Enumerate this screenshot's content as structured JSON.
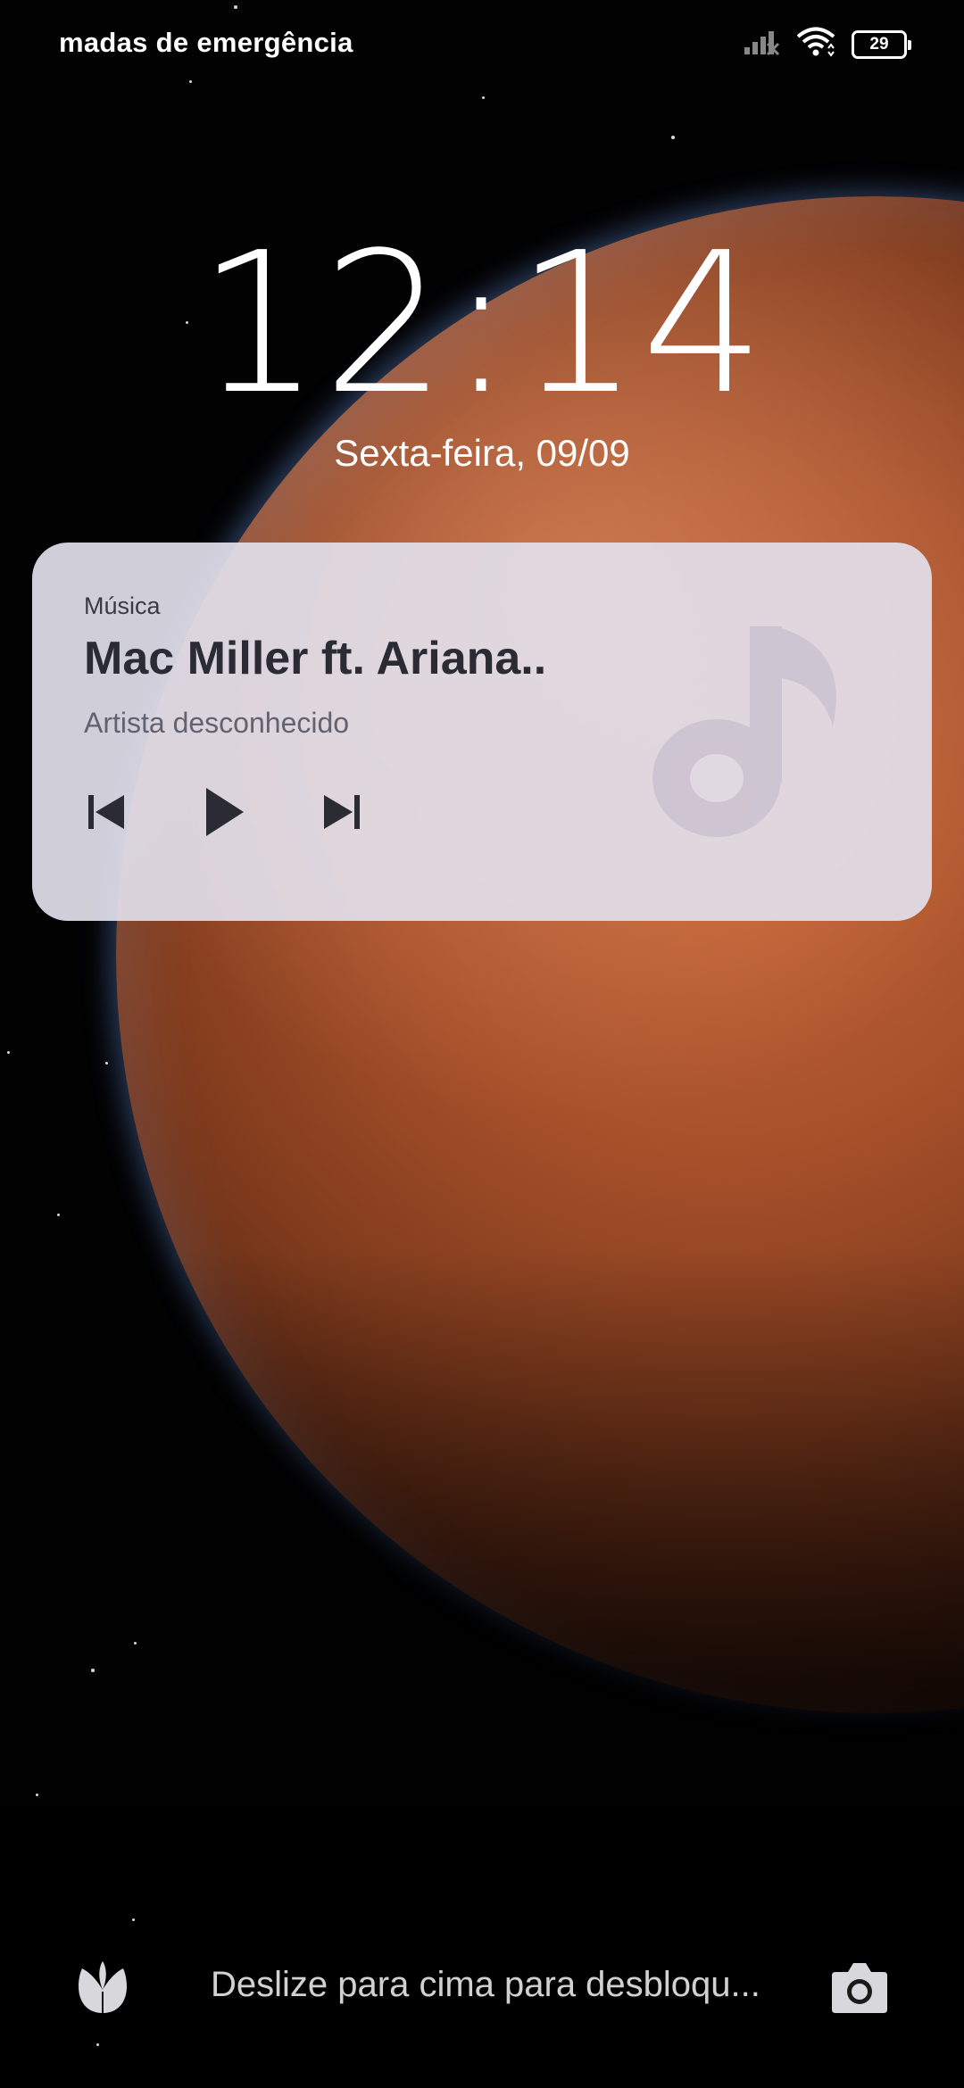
{
  "status_bar": {
    "carrier_text": "madas de emergência",
    "battery_level": "29",
    "icons": [
      "signal-icon",
      "wifi-icon",
      "battery-icon"
    ]
  },
  "lock_screen": {
    "time": "12:14",
    "date": "Sexta-feira, 09/09"
  },
  "music_widget": {
    "app_name": "Música",
    "track_title": "Mac Miller ft. Ariana..",
    "artist": "Artista desconhecido",
    "controls": [
      "previous-icon",
      "play-icon",
      "next-icon"
    ]
  },
  "bottom": {
    "unlock_hint": "Deslize para cima para desbloqu...",
    "left_shortcut": "tulip-icon",
    "right_shortcut": "camera-icon"
  },
  "colors": {
    "card_background": "#e2e0ec",
    "title_text": "#2b2b33",
    "planet": "#a6502a"
  }
}
